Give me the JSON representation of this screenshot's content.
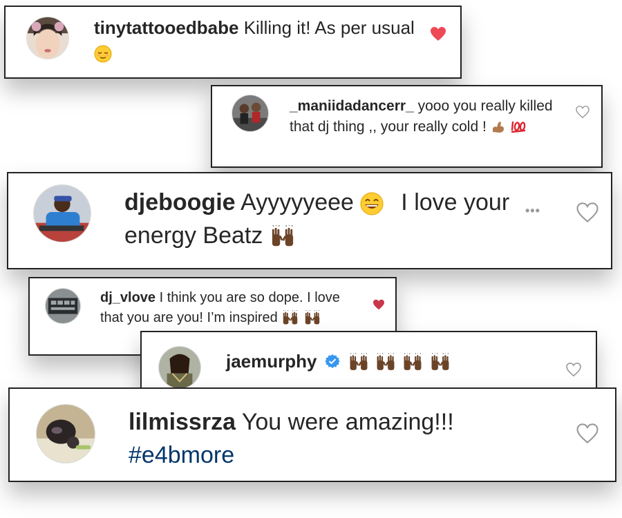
{
  "comments": [
    {
      "username": "tinytattooedbabe",
      "text": "Killing it! As per usual",
      "liked": true
    },
    {
      "username": "_maniidadancerr_",
      "text": "yooo you really killed that dj thing ,, your really cold !",
      "liked": false
    },
    {
      "username": "djeboogie",
      "text_before": "Ayyyyyeee",
      "text_after": "I love your energy Beatz",
      "liked": false,
      "more_label": "•••"
    },
    {
      "username": "dj_vlove",
      "text": "I think you are so dope. I love that you are you! I’m inspired",
      "liked": true
    },
    {
      "username": "jaemurphy",
      "verified": true,
      "liked": false
    },
    {
      "username": "lilmissrza",
      "text": "You were amazing!!!",
      "hashtag": "#e4bmore",
      "liked": false
    }
  ],
  "colors": {
    "liked_heart": "#ed4956",
    "unliked_heart": "#999999",
    "hashtag": "#003569",
    "verified": "#3897f0"
  }
}
